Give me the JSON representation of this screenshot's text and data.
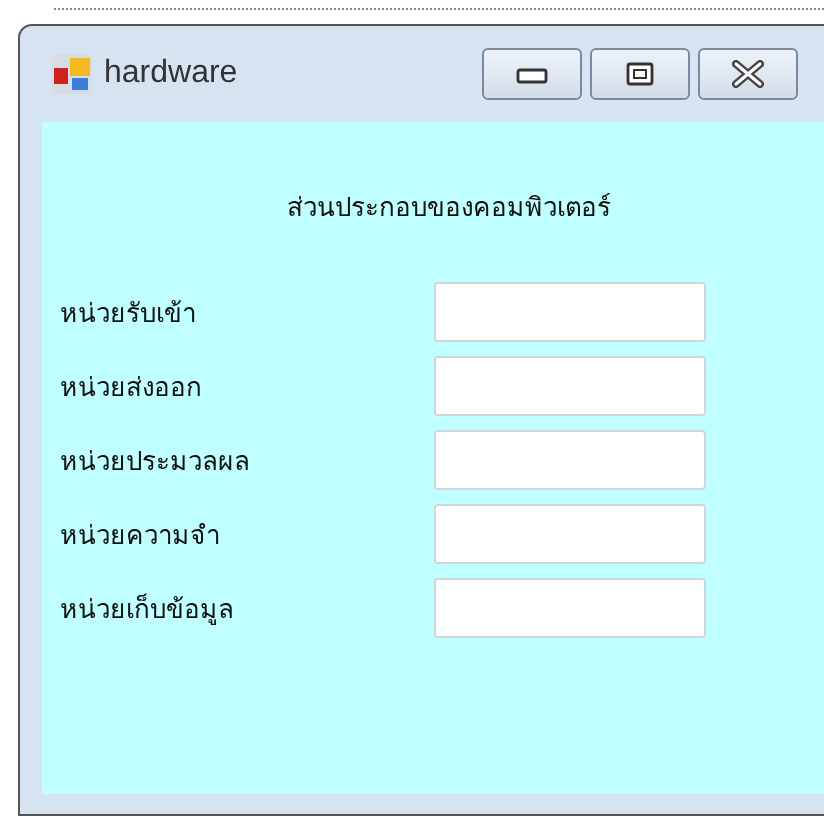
{
  "window": {
    "title": "hardware"
  },
  "heading": "ส่วนประกอบของคอมพิวเตอร์",
  "fields": [
    {
      "label": "หน่วยรับเข้า"
    },
    {
      "label": "หน่วยส่งออก"
    },
    {
      "label": "หน่วยประมวลผล"
    },
    {
      "label": "หน่วยความจำ"
    },
    {
      "label": "หน่วยเก็บข้อมูล"
    }
  ]
}
